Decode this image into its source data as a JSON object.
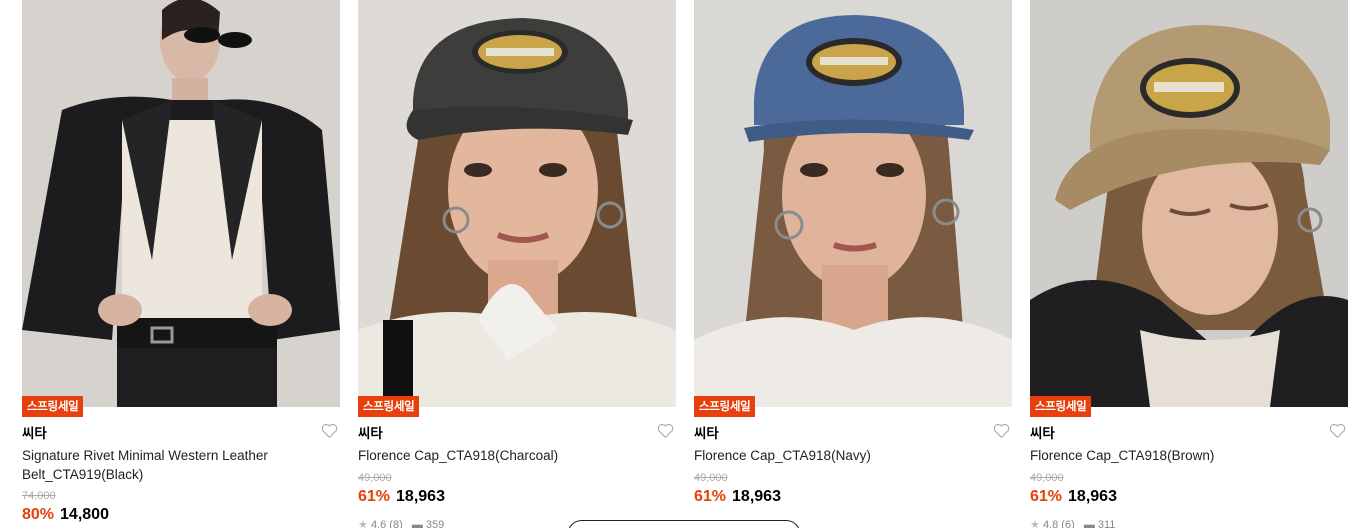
{
  "products": [
    {
      "badge": "스프링세일",
      "brand": "씨타",
      "name": "Signature Rivet Minimal Western Leather Belt_CTA919(Black)",
      "original_price": "74,000",
      "discount": "80%",
      "price": "14,800",
      "rating": "",
      "reviews": "",
      "likes": ""
    },
    {
      "badge": "스프링세일",
      "brand": "씨타",
      "name": "Florence Cap_CTA918(Charcoal)",
      "original_price": "49,000",
      "discount": "61%",
      "price": "18,963",
      "rating": "4.6",
      "reviews": "(8)",
      "likes": "359",
      "cap_color": "#3d3d3b"
    },
    {
      "badge": "스프링세일",
      "brand": "씨타",
      "name": "Florence Cap_CTA918(Navy)",
      "original_price": "49,000",
      "discount": "61%",
      "price": "18,963",
      "rating": "",
      "reviews": "",
      "likes": "",
      "cap_color": "#4c6a99"
    },
    {
      "badge": "스프링세일",
      "brand": "씨타",
      "name": "Florence Cap_CTA918(Brown)",
      "original_price": "49,000",
      "discount": "61%",
      "price": "18,963",
      "rating": "4.8",
      "reviews": "(6)",
      "likes": "311",
      "cap_color": "#b49a72"
    }
  ],
  "colors": {
    "accent": "#e8400c",
    "strike": "#aaaaaa"
  }
}
